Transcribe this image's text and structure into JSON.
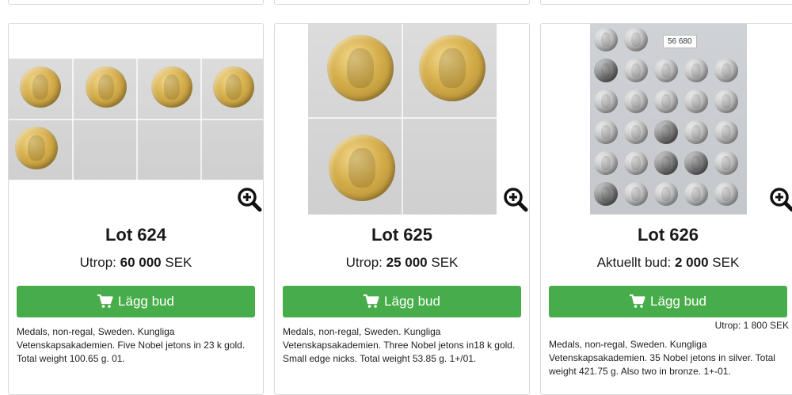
{
  "lots": [
    {
      "lot": "Lot 624",
      "price_label": "Utrop:",
      "price_value": "60 000",
      "currency": "SEK",
      "button": "Lägg bud",
      "description": "Medals, non-regal, Sweden. Kungliga Vetenskapsakademien. Five Nobel jetons in 23 k gold. Total weight 100.65 g. 01."
    },
    {
      "lot": "Lot 625",
      "price_label": "Utrop:",
      "price_value": "25 000",
      "currency": "SEK",
      "button": "Lägg bud",
      "description": "Medals, non-regal, Sweden. Kungliga Vetenskapsakademien. Three Nobel jetons in18 k gold. Small edge nicks. Total weight 53.85 g. 1+/01."
    },
    {
      "lot": "Lot 626",
      "price_label": "Aktuellt bud:",
      "price_value": "2 000",
      "currency": "SEK",
      "button": "Lägg bud",
      "start_price": "Utrop: 1 800 SEK",
      "photo_tag": "56 680",
      "description": "Medals, non-regal, Sweden. Kungliga Vetenskapsakademien. 35 Nobel jetons in silver. Total weight 421.75 g. Also two in bronze. 1+-01."
    }
  ],
  "icons": {
    "zoom": "zoom-in-icon",
    "cart": "cart-icon",
    "coin": "medal-icon"
  },
  "colors": {
    "button_green": "#47ad4a",
    "border": "#d9d9d9"
  }
}
